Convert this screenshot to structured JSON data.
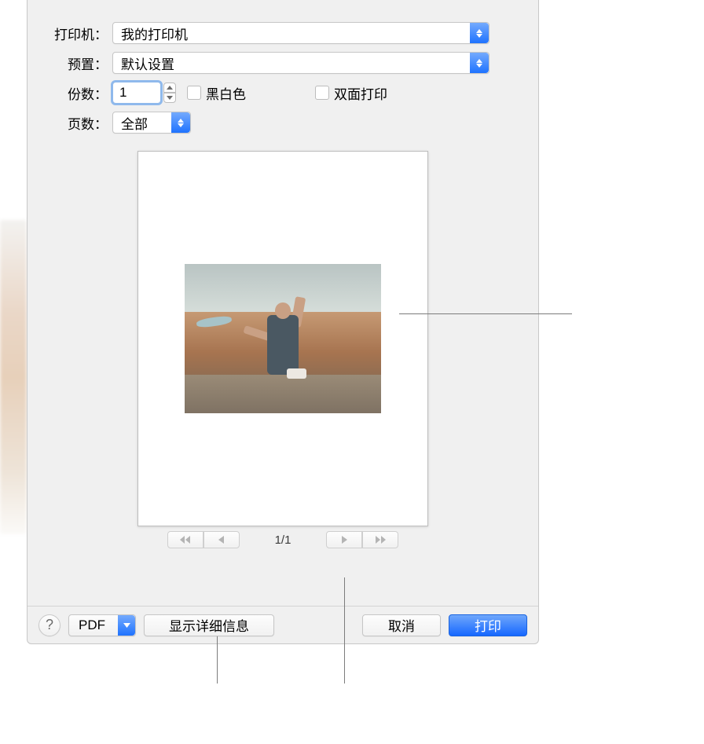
{
  "labels": {
    "printer": "打印机：",
    "presets": "预置：",
    "copies": "份数：",
    "pages": "页数："
  },
  "printer": {
    "value": "我的打印机"
  },
  "presets": {
    "value": "默认设置"
  },
  "copies": {
    "value": "1"
  },
  "checkboxes": {
    "bw": "黑白色",
    "duplex": "双面打印"
  },
  "pages": {
    "value": "全部"
  },
  "pager": {
    "counter": "1/1"
  },
  "bottom": {
    "help": "?",
    "pdf": "PDF",
    "details": "显示详细信息",
    "cancel": "取消",
    "print": "打印"
  }
}
